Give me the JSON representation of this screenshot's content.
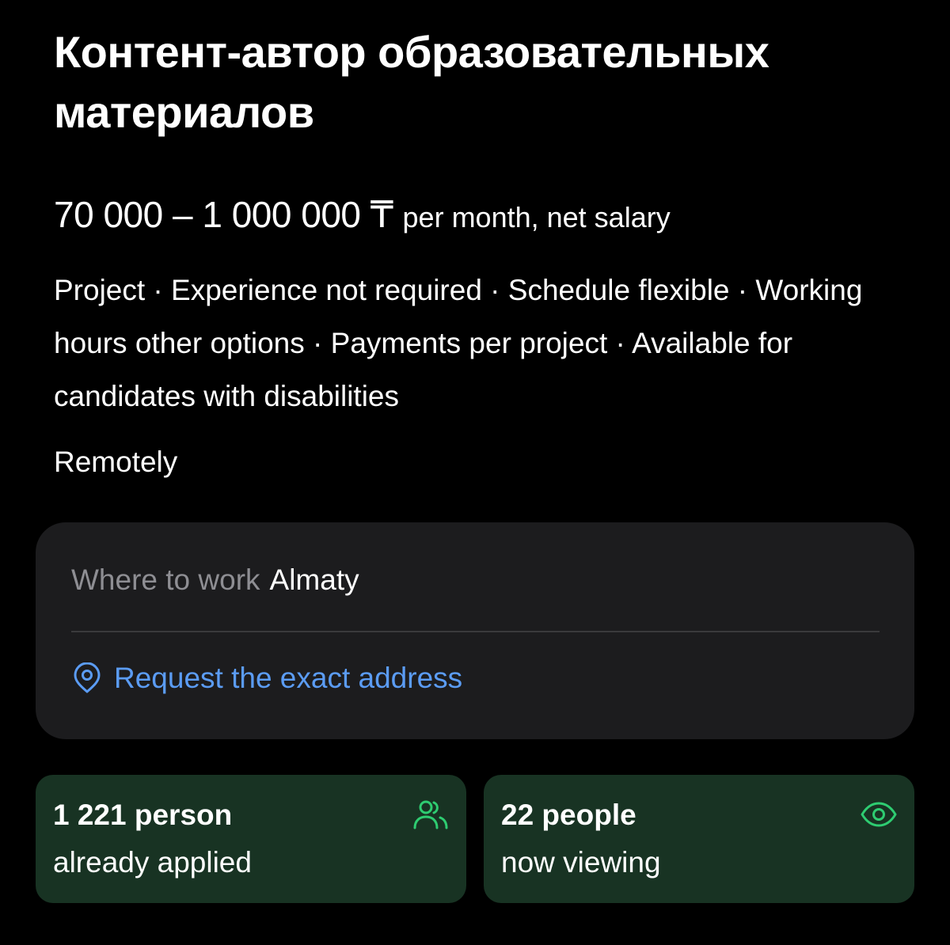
{
  "vacancy": {
    "title": "Контент-автор образовательных материалов",
    "salary_amount": "70 000 – 1 000 000 ₸",
    "salary_period": "per month, net salary",
    "tags": "Project · Experience not required · Schedule flexible · Working hours other options · Payments per project · Available for candidates with disabilities",
    "location": "Remotely"
  },
  "work_place": {
    "label": "Where to work",
    "city": "Almaty",
    "request_link": "Request the exact address",
    "link_color": "#5b9cf4",
    "icon": "location-pin-icon"
  },
  "stats": {
    "applied": {
      "count": "1 221 person",
      "desc": "already applied",
      "icon": "people-icon"
    },
    "viewing": {
      "count": "22 people",
      "desc": "now viewing",
      "icon": "eye-icon"
    },
    "accent_color": "#2ecc71",
    "card_color": "#183323"
  }
}
